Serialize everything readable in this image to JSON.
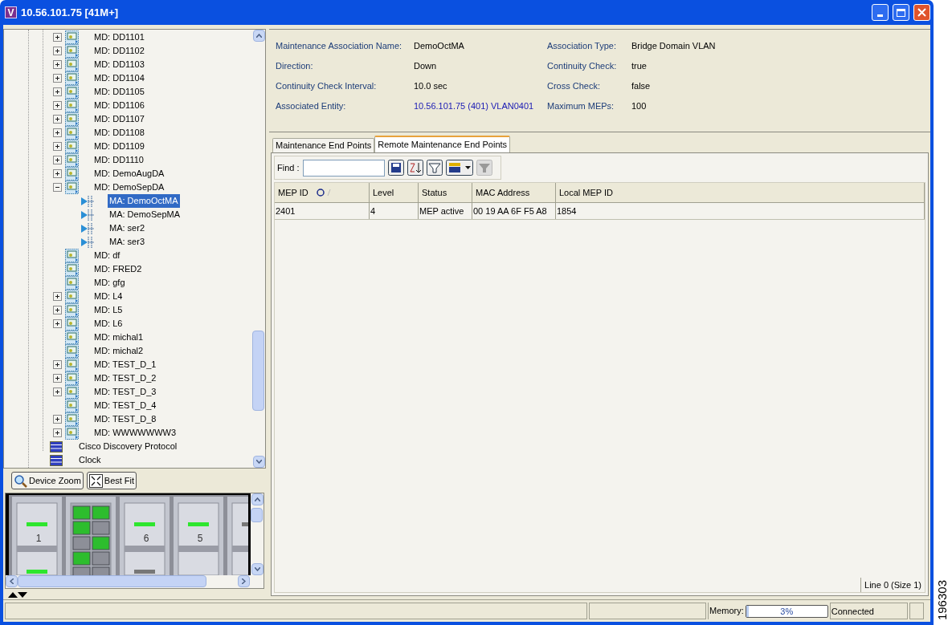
{
  "window": {
    "app_icon_letter": "V",
    "title": "10.56.101.75 [41M+]"
  },
  "tree": {
    "nested_items": [
      {
        "label": "MD: DD1101",
        "kind": "domain",
        "expanded": false,
        "selected": false
      },
      {
        "label": "MD: DD1102",
        "kind": "domain",
        "expanded": false,
        "selected": false
      },
      {
        "label": "MD: DD1103",
        "kind": "domain",
        "expanded": false,
        "selected": false
      },
      {
        "label": "MD: DD1104",
        "kind": "domain",
        "expanded": false,
        "selected": false
      },
      {
        "label": "MD: DD1105",
        "kind": "domain",
        "expanded": false,
        "selected": false
      },
      {
        "label": "MD: DD1106",
        "kind": "domain",
        "expanded": false,
        "selected": false
      },
      {
        "label": "MD: DD1107",
        "kind": "domain",
        "expanded": false,
        "selected": false
      },
      {
        "label": "MD: DD1108",
        "kind": "domain",
        "expanded": false,
        "selected": false
      },
      {
        "label": "MD: DD1109",
        "kind": "domain",
        "expanded": false,
        "selected": false
      },
      {
        "label": "MD: DD1110",
        "kind": "domain",
        "expanded": false,
        "selected": false
      },
      {
        "label": "MD: DemoAugDA",
        "kind": "domain",
        "expanded": false,
        "selected": false
      },
      {
        "label": "MD: DemoSepDA",
        "kind": "domain",
        "expanded": true,
        "selected": false,
        "children": [
          {
            "label": "MA: DemoOctMA",
            "kind": "association",
            "selected": true
          },
          {
            "label": "MA: DemoSepMA",
            "kind": "association",
            "selected": false
          },
          {
            "label": "MA: ser2",
            "kind": "association",
            "selected": false
          },
          {
            "label": "MA: ser3",
            "kind": "association",
            "selected": false
          }
        ]
      },
      {
        "label": "MD: df",
        "kind": "domain",
        "selected": false
      },
      {
        "label": "MD: FRED2",
        "kind": "domain",
        "selected": false
      },
      {
        "label": "MD: gfg",
        "kind": "domain",
        "selected": false
      },
      {
        "label": "MD: L4",
        "kind": "domain",
        "expanded": false,
        "selected": false
      },
      {
        "label": "MD: L5",
        "kind": "domain",
        "expanded": false,
        "selected": false
      },
      {
        "label": "MD: L6",
        "kind": "domain",
        "expanded": false,
        "selected": false
      },
      {
        "label": "MD: michal1",
        "kind": "domain",
        "selected": false
      },
      {
        "label": "MD: michal2",
        "kind": "domain",
        "selected": false
      },
      {
        "label": "MD: TEST_D_1",
        "kind": "domain",
        "expanded": false,
        "selected": false
      },
      {
        "label": "MD: TEST_D_2",
        "kind": "domain",
        "expanded": false,
        "selected": false
      },
      {
        "label": "MD: TEST_D_3",
        "kind": "domain",
        "expanded": false,
        "selected": false
      },
      {
        "label": "MD: TEST_D_4",
        "kind": "domain",
        "selected": false
      },
      {
        "label": "MD: TEST_D_8",
        "kind": "domain",
        "expanded": false,
        "selected": false
      },
      {
        "label": "MD: WWWWWWW3",
        "kind": "domain",
        "expanded": false,
        "selected": false
      }
    ],
    "items": [
      {
        "label": "Cisco Discovery Protocol",
        "kind": "protocol",
        "selected": false
      },
      {
        "label": "Clock",
        "kind": "protocol",
        "selected": false
      }
    ]
  },
  "device_toolbar": {
    "buttons": [
      {
        "label": "Device Zoom",
        "kind": "zoom"
      },
      {
        "label": "Best Fit",
        "kind": "fit"
      }
    ]
  },
  "device_view": {
    "slot_labels": [
      "1",
      "6",
      "5"
    ]
  },
  "properties": {
    "left": [
      {
        "label": "Maintenance Association Name:",
        "value": "DemoOctMA",
        "kind": "text"
      },
      {
        "label": "Direction:",
        "value": "Down",
        "kind": "text"
      },
      {
        "label": "Continuity Check Interval:",
        "value": "10.0 sec",
        "kind": "text"
      },
      {
        "label": "Associated Entity:",
        "value": "10.56.101.75 (401) VLAN0401",
        "kind": "link"
      }
    ],
    "right": [
      {
        "label": "Association Type:",
        "value": "Bridge Domain VLAN",
        "kind": "text"
      },
      {
        "label": "Continuity Check:",
        "value": "true",
        "kind": "text"
      },
      {
        "label": "Cross Check:",
        "value": "false",
        "kind": "text"
      },
      {
        "label": "Maximum MEPs:",
        "value": "100",
        "kind": "text"
      }
    ]
  },
  "tabs": [
    {
      "label": "Maintenance End Points",
      "selected": false
    },
    {
      "label": "Remote Maintenance End Points",
      "selected": true
    }
  ],
  "find": {
    "label": "Find :"
  },
  "table": {
    "columns": [
      {
        "label": "MEP ID",
        "sorted": true
      },
      {
        "label": "Level",
        "sorted": false
      },
      {
        "label": "Status",
        "sorted": false
      },
      {
        "label": "MAC Address",
        "sorted": false
      },
      {
        "label": "Local MEP ID",
        "sorted": false
      }
    ],
    "rows": [
      [
        "2401",
        "4",
        "MEP active",
        "00 19 AA 6F F5 A8",
        "1854"
      ]
    ],
    "footer": "Line 0 (Size 1)"
  },
  "status_bar": {
    "memory_label": "Memory:",
    "memory": {
      "level": 0.03,
      "reading": "3%"
    },
    "connection": "Connected"
  },
  "figure_number": "196303"
}
